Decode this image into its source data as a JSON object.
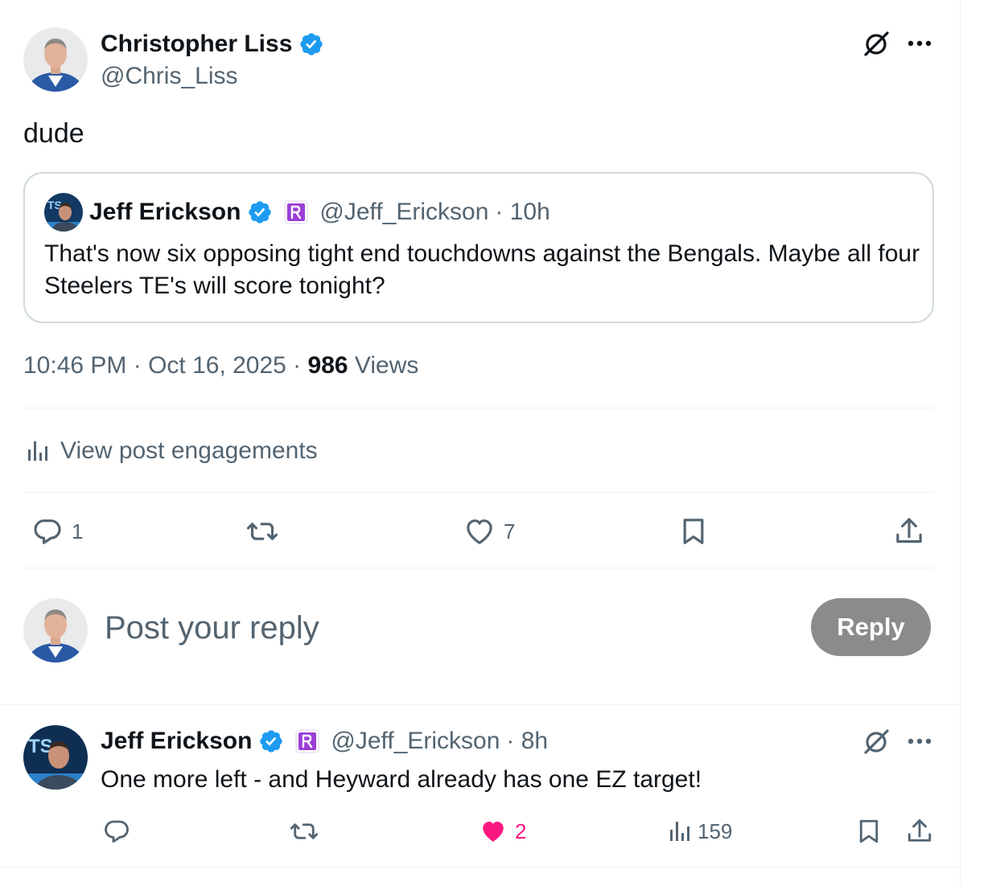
{
  "main_post": {
    "author_name": "Christopher Liss",
    "author_handle": "@Chris_Liss",
    "text": "dude",
    "timestamp": "10:46 PM · Oct 16, 2025 · ",
    "views_count": "986",
    "views_label": " Views",
    "engagements_label": "View post engagements",
    "actions": {
      "reply_count": "1",
      "retweet_count": "",
      "like_count": "7"
    }
  },
  "quoted_post": {
    "author_name": "Jeff Erickson",
    "author_handle": "@Jeff_Erickson",
    "time_ago": "· 10h",
    "text": "That's now six opposing tight end touchdowns against the Bengals. Maybe all four Steelers TE's will score tonight?"
  },
  "reply_composer": {
    "placeholder": "Post your reply",
    "button_label": "Reply"
  },
  "reply_post": {
    "author_name": "Jeff Erickson",
    "author_handle": "@Jeff_Erickson",
    "time_ago": "· 8h",
    "text": "One more left - and Heyward already has one EZ target!",
    "actions": {
      "like_count": "2",
      "views_count": "159"
    }
  },
  "icons": {
    "verified": "verified-badge-icon",
    "affiliate": "rotowire-affiliate-icon",
    "grok": "grok-icon",
    "more": "more-icon",
    "reply": "reply-icon",
    "retweet": "retweet-icon",
    "like": "like-icon",
    "bookmark": "bookmark-icon",
    "share": "share-icon",
    "analytics": "analytics-icon"
  },
  "colors": {
    "accent_blue": "#1d9bf0",
    "like_pink": "#f91880",
    "secondary_text": "#536471",
    "reply_button_disabled": "#8b8b8b",
    "affiliate_purple": "#9b3fd6"
  }
}
